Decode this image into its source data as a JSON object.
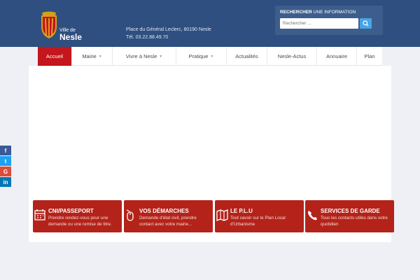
{
  "header": {
    "logo": {
      "prefix": "Ville de",
      "name": "Nesle"
    },
    "address_line1": "Place du Général Leclerc, 80190 Nesle",
    "address_line2": "Tél. 03.22.88.49.70",
    "search": {
      "title_bold": "RECHERCHER",
      "title_rest": " UNE INFORMATION",
      "placeholder": "Rechercher ...",
      "icon": "search-icon"
    }
  },
  "nav": {
    "items": [
      {
        "label": "Accueil",
        "active": true
      },
      {
        "label": "Mairie",
        "dropdown": true
      },
      {
        "label": "Vivre à Nesle",
        "dropdown": true
      },
      {
        "label": "Pratique",
        "dropdown": true
      },
      {
        "label": "Actualités"
      },
      {
        "label": "Nesle-Actus"
      },
      {
        "label": "Annuaire"
      },
      {
        "label": "Plan"
      }
    ]
  },
  "social": [
    {
      "glyph": "f",
      "name": "facebook-icon",
      "color": "#3b5998"
    },
    {
      "glyph": "t",
      "name": "twitter-icon",
      "color": "#1da1f2"
    },
    {
      "glyph": "G",
      "name": "google-plus-icon",
      "color": "#dd4b39"
    },
    {
      "glyph": "in",
      "name": "linkedin-icon",
      "color": "#0077b5"
    }
  ],
  "cards": [
    {
      "title": "CNI/PASSEPORT",
      "desc": "Prendre rendez-vous pour une demande ou une remise de titre.",
      "icon": "calendar-icon"
    },
    {
      "title": "VOS DÉMARCHES",
      "desc": "Demande d'état civil, prendre contact avec votre mairie...",
      "icon": "mouse-icon"
    },
    {
      "title": "LE P.L.U",
      "desc": "Tout savoir sur le Plan Local d'Urbanisme",
      "icon": "map-icon"
    },
    {
      "title": "SERVICES DE GARDE",
      "desc": "Tous les contacts utiles dans votre quotidien",
      "icon": "phone-icon"
    }
  ],
  "colors": {
    "header": "#2e4f7f",
    "accent": "#c4161c",
    "card": "#b3231a",
    "search_button": "#49a3e6"
  }
}
